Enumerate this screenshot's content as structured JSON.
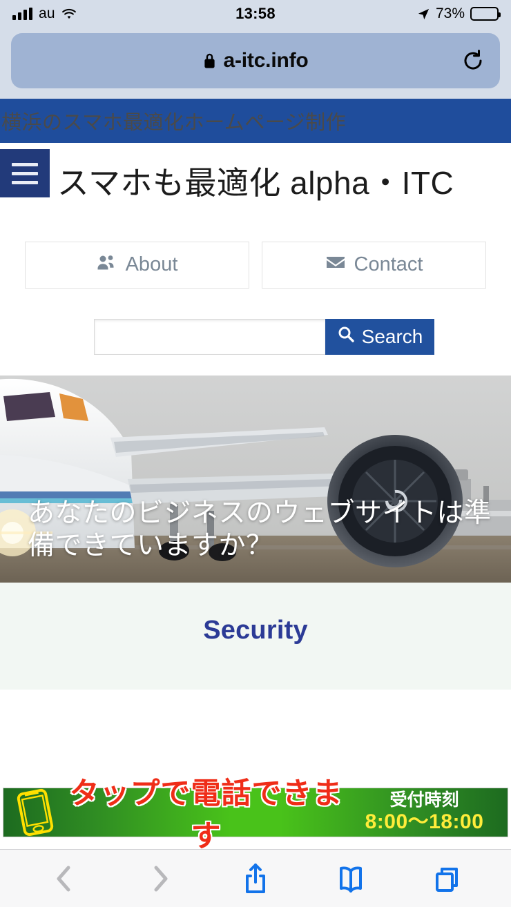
{
  "status_bar": {
    "carrier": "au",
    "time": "13:58",
    "battery_percent": "73%",
    "signal_icon": "signal-bars-icon",
    "wifi_icon": "wifi-icon",
    "location_icon": "location-arrow-icon",
    "battery_icon": "battery-icon"
  },
  "browser": {
    "url": "a-itc.info",
    "lock_icon": "lock-icon",
    "reload_icon": "reload-icon",
    "toolbar": {
      "back_label": "back-chevron-icon",
      "forward_label": "forward-chevron-icon",
      "share_label": "share-icon",
      "bookmarks_label": "book-icon",
      "tabs_label": "tabs-icon"
    }
  },
  "page": {
    "top_banner": "横浜のスマホ最適化ホームページ制作",
    "menu_icon": "hamburger-menu-icon",
    "site_title": "スマホも最適化 alpha・ITC",
    "nav_buttons": [
      {
        "label": "About",
        "icon": "users-icon"
      },
      {
        "label": "Contact",
        "icon": "envelope-icon"
      }
    ],
    "search": {
      "value": "",
      "placeholder": "",
      "button_label": "Search",
      "button_icon": "search-icon"
    },
    "hero": {
      "overlay_text": "あなたのビジネスのウェブサイトは準備できていますか？",
      "image_alt": "airplane-on-runway-photo"
    },
    "security_section": {
      "title": "Security"
    },
    "call_banner": {
      "icon": "smartphone-icon",
      "main_text": "タップで電話できます",
      "hours_label": "受付時刻",
      "hours_value": "8:00〜18:00"
    }
  },
  "colors": {
    "brand_blue": "#1f4d9c",
    "menu_navy": "#223a7a",
    "search_blue": "#21519e",
    "security_navy": "#2c3b96",
    "banner_green": "#49c21a",
    "banner_red": "#ef2d18",
    "banner_yellow": "#ffec3a",
    "safari_chrome": "#d5dde9",
    "url_pill": "#9fb3d3",
    "toolbar_blue": "#1273ea"
  }
}
